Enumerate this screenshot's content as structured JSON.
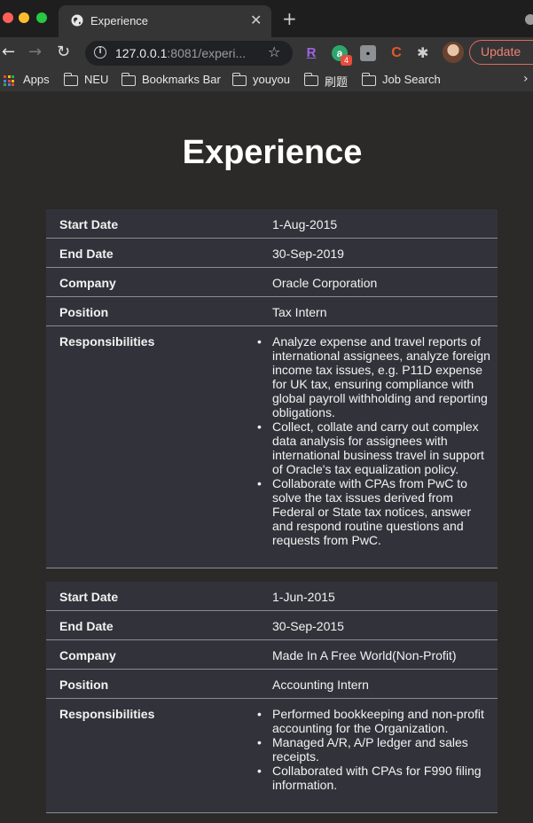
{
  "browser": {
    "tab_title": "Experience",
    "url_host": "127.0.0.1",
    "url_rest": ":8081/experi...",
    "update_label": "Update",
    "ext_badge": "4",
    "bookmarks": [
      "Apps",
      "NEU",
      "Bookmarks Bar",
      "youyou",
      "刷题",
      "Job Search"
    ]
  },
  "page": {
    "title": "Experience",
    "labels": {
      "start": "Start Date",
      "end": "End Date",
      "company": "Company",
      "position": "Position",
      "responsibilities": "Responsibilities"
    },
    "entries": [
      {
        "start_date": "1-Aug-2015",
        "end_date": "30-Sep-2019",
        "company": "Oracle Corporation",
        "position": "Tax Intern",
        "responsibilities": [
          "Analyze expense and travel reports of international assignees, analyze foreign income tax issues, e.g. P11D expense for UK tax, ensuring compliance with global payroll withholding and reporting obligations.",
          "Collect, collate and carry out complex data analysis for assignees with international business travel in support of Oracle's tax equalization policy.",
          "Collaborate with CPAs from PwC to solve the tax issues derived from Federal or State tax notices, answer and respond routine questions and requests from PwC."
        ]
      },
      {
        "start_date": "1-Jun-2015",
        "end_date": "30-Sep-2015",
        "company": "Made In A Free World(Non-Profit)",
        "position": "Accounting Intern",
        "responsibilities": [
          "Performed bookkeeping and non-profit accounting for the Organization.",
          "Managed A/R, A/P ledger and sales receipts.",
          "Collaborated with CPAs for F990 filing information."
        ]
      }
    ]
  }
}
